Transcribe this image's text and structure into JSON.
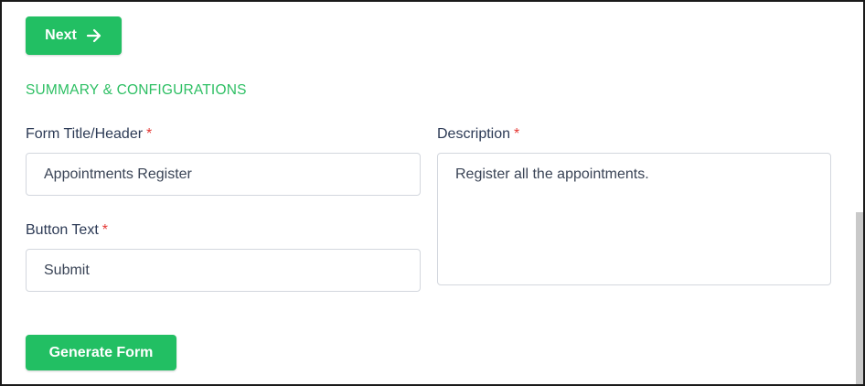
{
  "next_button": {
    "label": "Next",
    "icon": "arrow-right-icon"
  },
  "section": {
    "title": "SUMMARY & CONFIGURATIONS"
  },
  "fields": {
    "form_title": {
      "label": "Form Title/Header",
      "required_mark": "*",
      "value": "Appointments Register"
    },
    "description": {
      "label": "Description",
      "required_mark": "*",
      "value": "Register all the appointments."
    },
    "button_text": {
      "label": "Button Text",
      "required_mark": "*",
      "value": "Submit"
    }
  },
  "generate_button": {
    "label": "Generate Form"
  },
  "colors": {
    "accent": "#22bf63",
    "section_title": "#2dbf63",
    "required": "#e53935",
    "text": "#2c3a55"
  }
}
